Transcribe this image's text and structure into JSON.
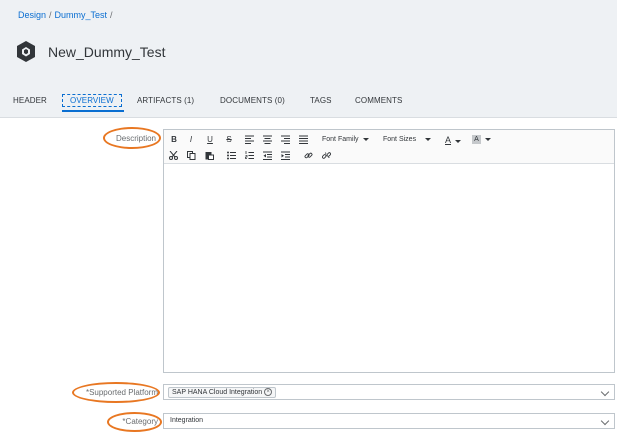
{
  "breadcrumb": {
    "items": [
      "Design",
      "Dummy_Test"
    ],
    "separator": "/"
  },
  "object": {
    "icon": "artifact-cube-icon",
    "title": "New_Dummy_Test"
  },
  "tabs": [
    {
      "label": "HEADER"
    },
    {
      "label": "OVERVIEW",
      "active": true
    },
    {
      "label": "ARTIFACTS (1)"
    },
    {
      "label": "DOCUMENTS (0)"
    },
    {
      "label": "TAGS"
    },
    {
      "label": "COMMENTS"
    }
  ],
  "form": {
    "description": {
      "label": "Description",
      "value": ""
    },
    "supported_platform": {
      "label": "*Supported Platform",
      "token": "SAP HANA Cloud Integration"
    },
    "category": {
      "label": "*Category",
      "value": "Integration"
    }
  },
  "toolbar": {
    "row1": [
      "B",
      "I",
      "U",
      "S"
    ],
    "font_family": "Font Family",
    "font_sizes": "Font Sizes",
    "text_color": "A",
    "bg_color": "A"
  },
  "colors": {
    "accent": "#0a6ed1",
    "highlight_ring": "#e87722",
    "header_bg": "#eef1f4"
  }
}
